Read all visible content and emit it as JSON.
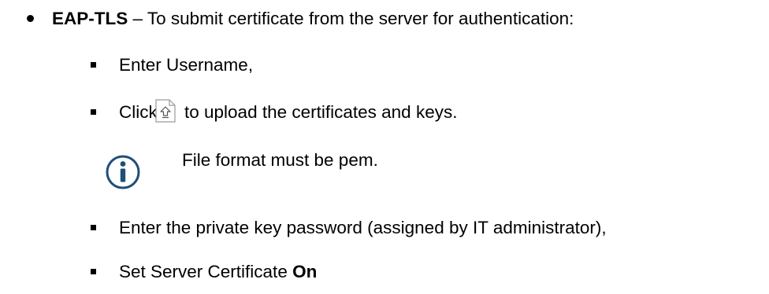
{
  "main_item": {
    "term": "EAP-TLS",
    "description": " – To submit certificate from the server for authentication:"
  },
  "sub_items": {
    "username": "Enter Username,",
    "click_prefix": "Click",
    "click_suffix": "to upload the certificates and keys.",
    "private_key": "Enter the private key password (assigned by IT administrator),",
    "server_cert_prefix": "Set Server Certificate ",
    "server_cert_value": "On"
  },
  "note": {
    "text": "File format must be pem."
  },
  "icons": {
    "upload": "file-upload-icon",
    "info": "info-icon"
  },
  "colors": {
    "info_icon": "#1f4e79",
    "upload_icon_border": "#9a9a9a"
  }
}
